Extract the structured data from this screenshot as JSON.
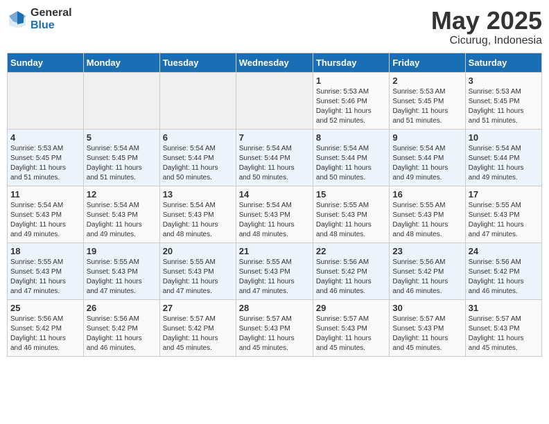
{
  "header": {
    "logo_general": "General",
    "logo_blue": "Blue",
    "month": "May 2025",
    "location": "Cicurug, Indonesia"
  },
  "weekdays": [
    "Sunday",
    "Monday",
    "Tuesday",
    "Wednesday",
    "Thursday",
    "Friday",
    "Saturday"
  ],
  "weeks": [
    [
      {
        "day": "",
        "info": ""
      },
      {
        "day": "",
        "info": ""
      },
      {
        "day": "",
        "info": ""
      },
      {
        "day": "",
        "info": ""
      },
      {
        "day": "1",
        "info": "Sunrise: 5:53 AM\nSunset: 5:46 PM\nDaylight: 11 hours\nand 52 minutes."
      },
      {
        "day": "2",
        "info": "Sunrise: 5:53 AM\nSunset: 5:45 PM\nDaylight: 11 hours\nand 51 minutes."
      },
      {
        "day": "3",
        "info": "Sunrise: 5:53 AM\nSunset: 5:45 PM\nDaylight: 11 hours\nand 51 minutes."
      }
    ],
    [
      {
        "day": "4",
        "info": "Sunrise: 5:53 AM\nSunset: 5:45 PM\nDaylight: 11 hours\nand 51 minutes."
      },
      {
        "day": "5",
        "info": "Sunrise: 5:54 AM\nSunset: 5:45 PM\nDaylight: 11 hours\nand 51 minutes."
      },
      {
        "day": "6",
        "info": "Sunrise: 5:54 AM\nSunset: 5:44 PM\nDaylight: 11 hours\nand 50 minutes."
      },
      {
        "day": "7",
        "info": "Sunrise: 5:54 AM\nSunset: 5:44 PM\nDaylight: 11 hours\nand 50 minutes."
      },
      {
        "day": "8",
        "info": "Sunrise: 5:54 AM\nSunset: 5:44 PM\nDaylight: 11 hours\nand 50 minutes."
      },
      {
        "day": "9",
        "info": "Sunrise: 5:54 AM\nSunset: 5:44 PM\nDaylight: 11 hours\nand 49 minutes."
      },
      {
        "day": "10",
        "info": "Sunrise: 5:54 AM\nSunset: 5:44 PM\nDaylight: 11 hours\nand 49 minutes."
      }
    ],
    [
      {
        "day": "11",
        "info": "Sunrise: 5:54 AM\nSunset: 5:43 PM\nDaylight: 11 hours\nand 49 minutes."
      },
      {
        "day": "12",
        "info": "Sunrise: 5:54 AM\nSunset: 5:43 PM\nDaylight: 11 hours\nand 49 minutes."
      },
      {
        "day": "13",
        "info": "Sunrise: 5:54 AM\nSunset: 5:43 PM\nDaylight: 11 hours\nand 48 minutes."
      },
      {
        "day": "14",
        "info": "Sunrise: 5:54 AM\nSunset: 5:43 PM\nDaylight: 11 hours\nand 48 minutes."
      },
      {
        "day": "15",
        "info": "Sunrise: 5:55 AM\nSunset: 5:43 PM\nDaylight: 11 hours\nand 48 minutes."
      },
      {
        "day": "16",
        "info": "Sunrise: 5:55 AM\nSunset: 5:43 PM\nDaylight: 11 hours\nand 48 minutes."
      },
      {
        "day": "17",
        "info": "Sunrise: 5:55 AM\nSunset: 5:43 PM\nDaylight: 11 hours\nand 47 minutes."
      }
    ],
    [
      {
        "day": "18",
        "info": "Sunrise: 5:55 AM\nSunset: 5:43 PM\nDaylight: 11 hours\nand 47 minutes."
      },
      {
        "day": "19",
        "info": "Sunrise: 5:55 AM\nSunset: 5:43 PM\nDaylight: 11 hours\nand 47 minutes."
      },
      {
        "day": "20",
        "info": "Sunrise: 5:55 AM\nSunset: 5:43 PM\nDaylight: 11 hours\nand 47 minutes."
      },
      {
        "day": "21",
        "info": "Sunrise: 5:55 AM\nSunset: 5:43 PM\nDaylight: 11 hours\nand 47 minutes."
      },
      {
        "day": "22",
        "info": "Sunrise: 5:56 AM\nSunset: 5:42 PM\nDaylight: 11 hours\nand 46 minutes."
      },
      {
        "day": "23",
        "info": "Sunrise: 5:56 AM\nSunset: 5:42 PM\nDaylight: 11 hours\nand 46 minutes."
      },
      {
        "day": "24",
        "info": "Sunrise: 5:56 AM\nSunset: 5:42 PM\nDaylight: 11 hours\nand 46 minutes."
      }
    ],
    [
      {
        "day": "25",
        "info": "Sunrise: 5:56 AM\nSunset: 5:42 PM\nDaylight: 11 hours\nand 46 minutes."
      },
      {
        "day": "26",
        "info": "Sunrise: 5:56 AM\nSunset: 5:42 PM\nDaylight: 11 hours\nand 46 minutes."
      },
      {
        "day": "27",
        "info": "Sunrise: 5:57 AM\nSunset: 5:42 PM\nDaylight: 11 hours\nand 45 minutes."
      },
      {
        "day": "28",
        "info": "Sunrise: 5:57 AM\nSunset: 5:43 PM\nDaylight: 11 hours\nand 45 minutes."
      },
      {
        "day": "29",
        "info": "Sunrise: 5:57 AM\nSunset: 5:43 PM\nDaylight: 11 hours\nand 45 minutes."
      },
      {
        "day": "30",
        "info": "Sunrise: 5:57 AM\nSunset: 5:43 PM\nDaylight: 11 hours\nand 45 minutes."
      },
      {
        "day": "31",
        "info": "Sunrise: 5:57 AM\nSunset: 5:43 PM\nDaylight: 11 hours\nand 45 minutes."
      }
    ]
  ]
}
